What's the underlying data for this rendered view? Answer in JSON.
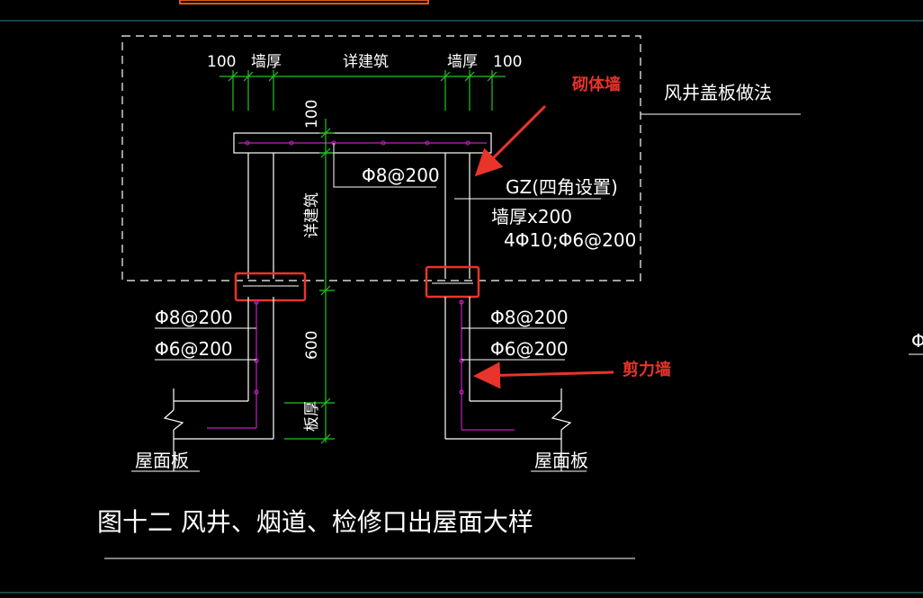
{
  "colors": {
    "background": "#000000",
    "line": "#ffffff",
    "dimension": "#22c422",
    "rebar": "#c020c0",
    "annotation": "#e8342a",
    "frame_line": "#2a8a8a"
  },
  "dimensions": {
    "left_100": "100",
    "left_wall": "墙厚",
    "middle": "详建筑",
    "right_wall": "墙厚",
    "right_100": "100",
    "vertical_100": "100",
    "vertical_middle": "详建筑",
    "vertical_600": "600",
    "vertical_bottom": "板厚"
  },
  "labels": {
    "cover_title": "风井盖板做法",
    "slab_rebar": "Φ8@200",
    "gz": "GZ(四角设置)",
    "gz_size": "墙厚x200",
    "gz_rebar": "4Φ10;Φ6@200",
    "left_rebar_1": "Φ8@200",
    "left_rebar_2": "Φ6@200",
    "right_rebar_1": "Φ8@200",
    "right_rebar_2": "Φ6@200",
    "left_roof": "屋面板",
    "right_roof": "屋面板",
    "right_edge": "Φ"
  },
  "annotations": {
    "masonry_wall": "砌体墙",
    "shear_wall": "剪力墙"
  },
  "figure_title": "图十二  风井、烟道、检修口出屋面大样"
}
